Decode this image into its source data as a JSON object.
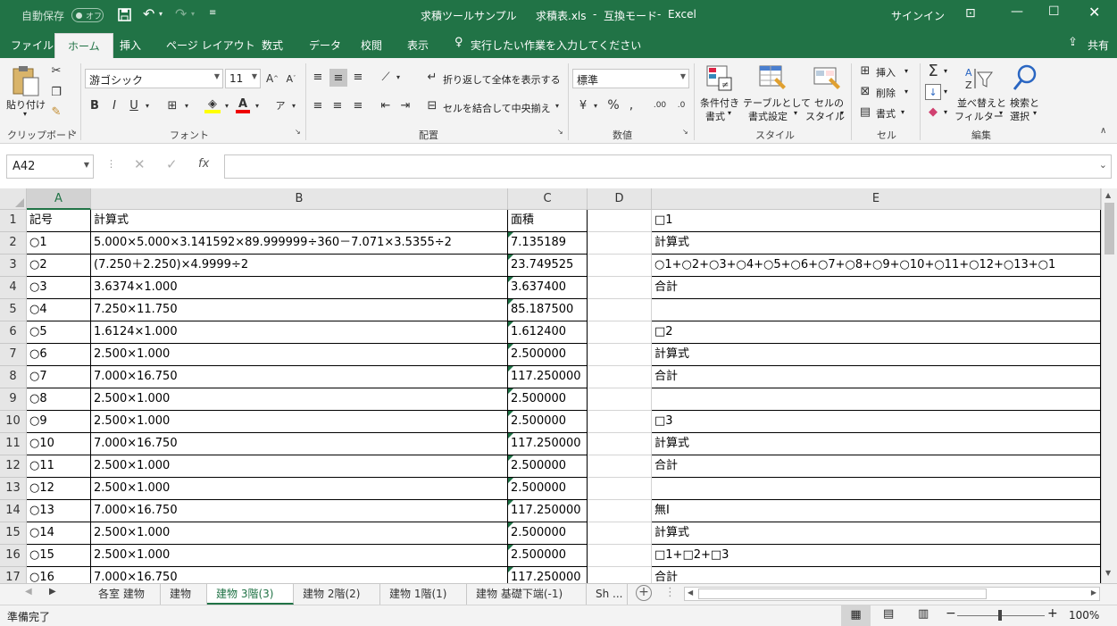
{
  "titlebar": {
    "autosave": "自動保存",
    "autosave_state": "オフ",
    "title_part1": "求積ツールサンプル",
    "title_part2": "求積表.xls",
    "title_part3": "互換モード",
    "title_part4": "Excel",
    "signin": "サインイン",
    "sep": "-"
  },
  "tabs": [
    "ファイル",
    "ホーム",
    "挿入",
    "ページ レイアウト",
    "数式",
    "データ",
    "校閲",
    "表示"
  ],
  "tell_me": "実行したい作業を入力してください",
  "share": "共有",
  "ribbon": {
    "paste": "貼り付け",
    "clipboard": "クリップボード",
    "font_name": "游ゴシック",
    "font_size": "11",
    "font_group": "フォント",
    "wrap": "折り返して全体を表示する",
    "merge": "セルを結合して中央揃え",
    "align_group": "配置",
    "number_format": "標準",
    "number_group": "数値",
    "cond_fmt_1": "条件付き",
    "cond_fmt_2": "書式",
    "table_fmt_1": "テーブルとして",
    "table_fmt_2": "書式設定",
    "cell_style_1": "セルの",
    "cell_style_2": "スタイル",
    "style_group": "スタイル",
    "insert": "挿入",
    "delete": "削除",
    "format": "書式",
    "cells_group": "セル",
    "sort_1": "並べ替えと",
    "sort_2": "フィルター",
    "find_1": "検索と",
    "find_2": "選択",
    "edit_group": "編集"
  },
  "formula_bar": {
    "name_box": "A42",
    "formula": ""
  },
  "columns": [
    "A",
    "B",
    "C",
    "D",
    "E"
  ],
  "rows": [
    {
      "n": "1",
      "a": "記号",
      "b": "計算式",
      "c": "面積",
      "e": "□1"
    },
    {
      "n": "2",
      "a": "○1",
      "b": "5.000×5.000×3.141592×89.999999÷360－7.071×3.5355÷2",
      "c": "7.135189",
      "e": "計算式"
    },
    {
      "n": "3",
      "a": "○2",
      "b": "(7.250＋2.250)×4.9999÷2",
      "c": "23.749525",
      "e": "○1+○2+○3+○4+○5+○6+○7+○8+○9+○10+○11+○12+○13+○1"
    },
    {
      "n": "4",
      "a": "○3",
      "b": "3.6374×1.000",
      "c": "3.637400",
      "e": "合計"
    },
    {
      "n": "5",
      "a": "○4",
      "b": "7.250×11.750",
      "c": "85.187500",
      "e": ""
    },
    {
      "n": "6",
      "a": "○5",
      "b": "1.6124×1.000",
      "c": "1.612400",
      "e": "□2"
    },
    {
      "n": "7",
      "a": "○6",
      "b": "2.500×1.000",
      "c": "2.500000",
      "e": "計算式"
    },
    {
      "n": "8",
      "a": "○7",
      "b": "7.000×16.750",
      "c": "117.250000",
      "e": "合計"
    },
    {
      "n": "9",
      "a": "○8",
      "b": "2.500×1.000",
      "c": "2.500000",
      "e": ""
    },
    {
      "n": "10",
      "a": "○9",
      "b": "2.500×1.000",
      "c": "2.500000",
      "e": "□3"
    },
    {
      "n": "11",
      "a": "○10",
      "b": "7.000×16.750",
      "c": "117.250000",
      "e": "計算式"
    },
    {
      "n": "12",
      "a": "○11",
      "b": "2.500×1.000",
      "c": "2.500000",
      "e": "合計"
    },
    {
      "n": "13",
      "a": "○12",
      "b": "2.500×1.000",
      "c": "2.500000",
      "e": ""
    },
    {
      "n": "14",
      "a": "○13",
      "b": "7.000×16.750",
      "c": "117.250000",
      "e": "無I"
    },
    {
      "n": "15",
      "a": "○14",
      "b": "2.500×1.000",
      "c": "2.500000",
      "e": "計算式"
    },
    {
      "n": "16",
      "a": "○15",
      "b": "2.500×1.000",
      "c": "2.500000",
      "e": "□1+□2+□3"
    },
    {
      "n": "17",
      "a": "○16",
      "b": "7.000×16.750",
      "c": "117.250000",
      "e": "合計"
    }
  ],
  "sheets": [
    "各室 建物",
    "建物",
    "建物 3階(3)",
    "建物 2階(2)",
    "建物 1階(1)",
    "建物 基礎下端(-1)",
    "Sh ..."
  ],
  "active_sheet": 2,
  "status": {
    "ready": "準備完了",
    "zoom": "100%"
  },
  "colors": {
    "accent": "#217346"
  }
}
